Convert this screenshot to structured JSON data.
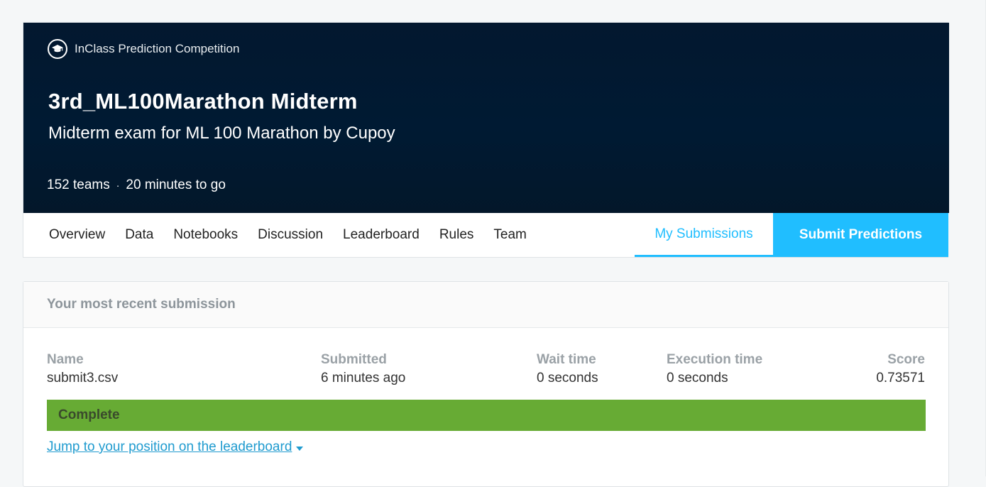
{
  "competition": {
    "type_label": "InClass Prediction Competition",
    "type_icon": "graduation-cap-icon",
    "title": "3rd_ML100Marathon Midterm",
    "subtitle": "Midterm exam for ML 100 Marathon by Cupoy",
    "teams": "152 teams",
    "separator": "·",
    "time_left": "20 minutes to go"
  },
  "tabs": [
    {
      "label": "Overview"
    },
    {
      "label": "Data"
    },
    {
      "label": "Notebooks"
    },
    {
      "label": "Discussion"
    },
    {
      "label": "Leaderboard"
    },
    {
      "label": "Rules"
    },
    {
      "label": "Team"
    }
  ],
  "active_tab": {
    "label": "My Submissions"
  },
  "submit_button": {
    "label": "Submit Predictions"
  },
  "recent_submission": {
    "title": "Your most recent submission",
    "columns": {
      "name": {
        "label": "Name",
        "value": "submit3.csv"
      },
      "submitted": {
        "label": "Submitted",
        "value": "6 minutes ago"
      },
      "wait_time": {
        "label": "Wait time",
        "value": "0 seconds"
      },
      "execution_time": {
        "label": "Execution time",
        "value": "0 seconds"
      },
      "score": {
        "label": "Score",
        "value": "0.73571"
      }
    },
    "status": "Complete",
    "jump_link": "Jump to your position on the leaderboard"
  },
  "colors": {
    "hero_bg": "#001a33",
    "accent": "#20beff",
    "status_complete": "#67ab34",
    "link": "#1f9bcf"
  }
}
